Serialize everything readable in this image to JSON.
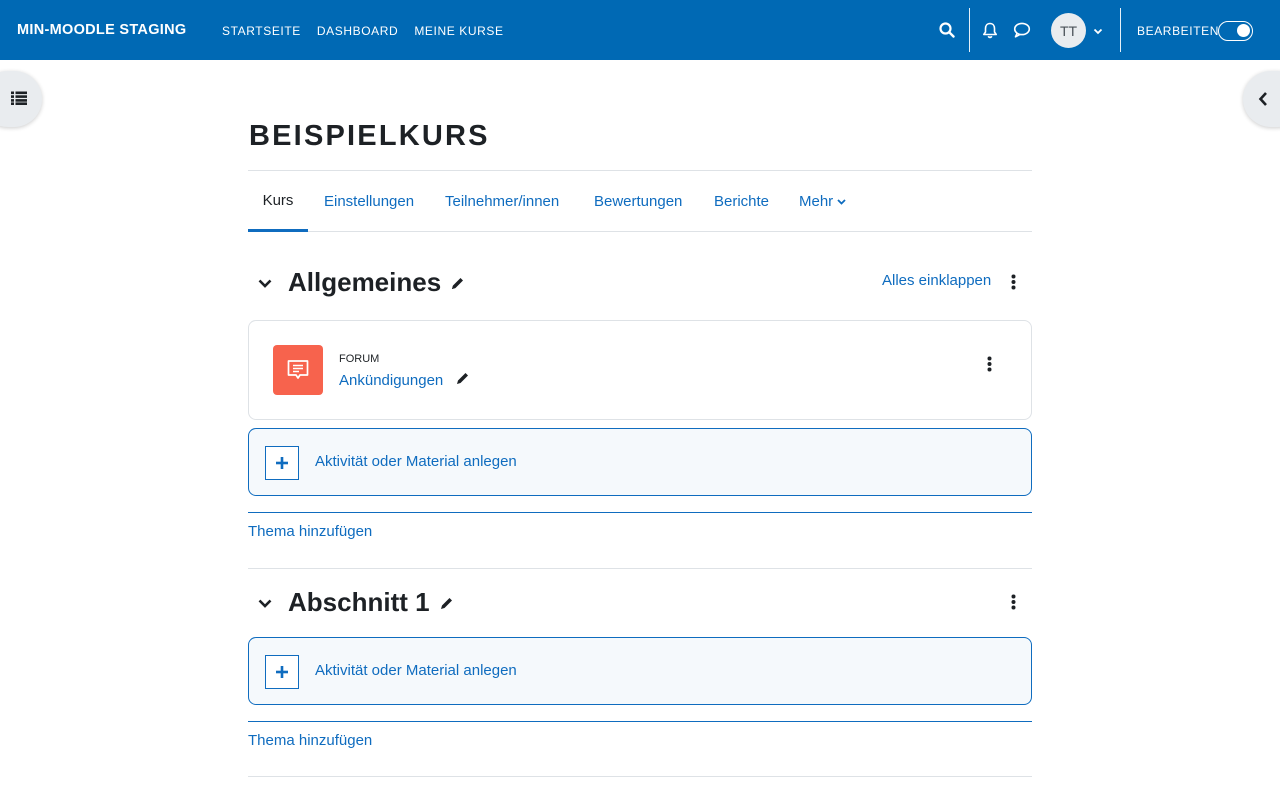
{
  "header": {
    "brand": "MIN-MOODLE STAGING",
    "nav": [
      "STARTSEITE",
      "DASHBOARD",
      "MEINE KURSE"
    ],
    "avatar_initials": "TT",
    "edit_mode_label": "BEARBEITEN",
    "edit_mode_on": true,
    "icons": [
      "search-icon",
      "bell-icon",
      "chat-icon",
      "chevron-down-icon"
    ]
  },
  "course": {
    "title": "BEISPIELKURS",
    "tabs": [
      "Kurs",
      "Einstellungen",
      "Teilnehmer/innen",
      "Bewertungen",
      "Berichte",
      "Mehr"
    ],
    "active_tab": "Kurs",
    "collapse_all": "Alles einklappen"
  },
  "sections": [
    {
      "title": "Allgemeines",
      "activities": [
        {
          "type": "FORUM",
          "name": "Ankündigungen"
        }
      ],
      "add_activity": "Aktivität oder Material anlegen",
      "add_topic": "Thema hinzufügen"
    },
    {
      "title": "Abschnitt 1",
      "activities": [],
      "add_activity": "Aktivität oder Material anlegen",
      "add_topic": "Thema hinzufügen"
    }
  ],
  "colors": {
    "header_bg": "#0069b4",
    "link": "#0f6cbf",
    "forum_icon_bg": "#f7634d"
  }
}
